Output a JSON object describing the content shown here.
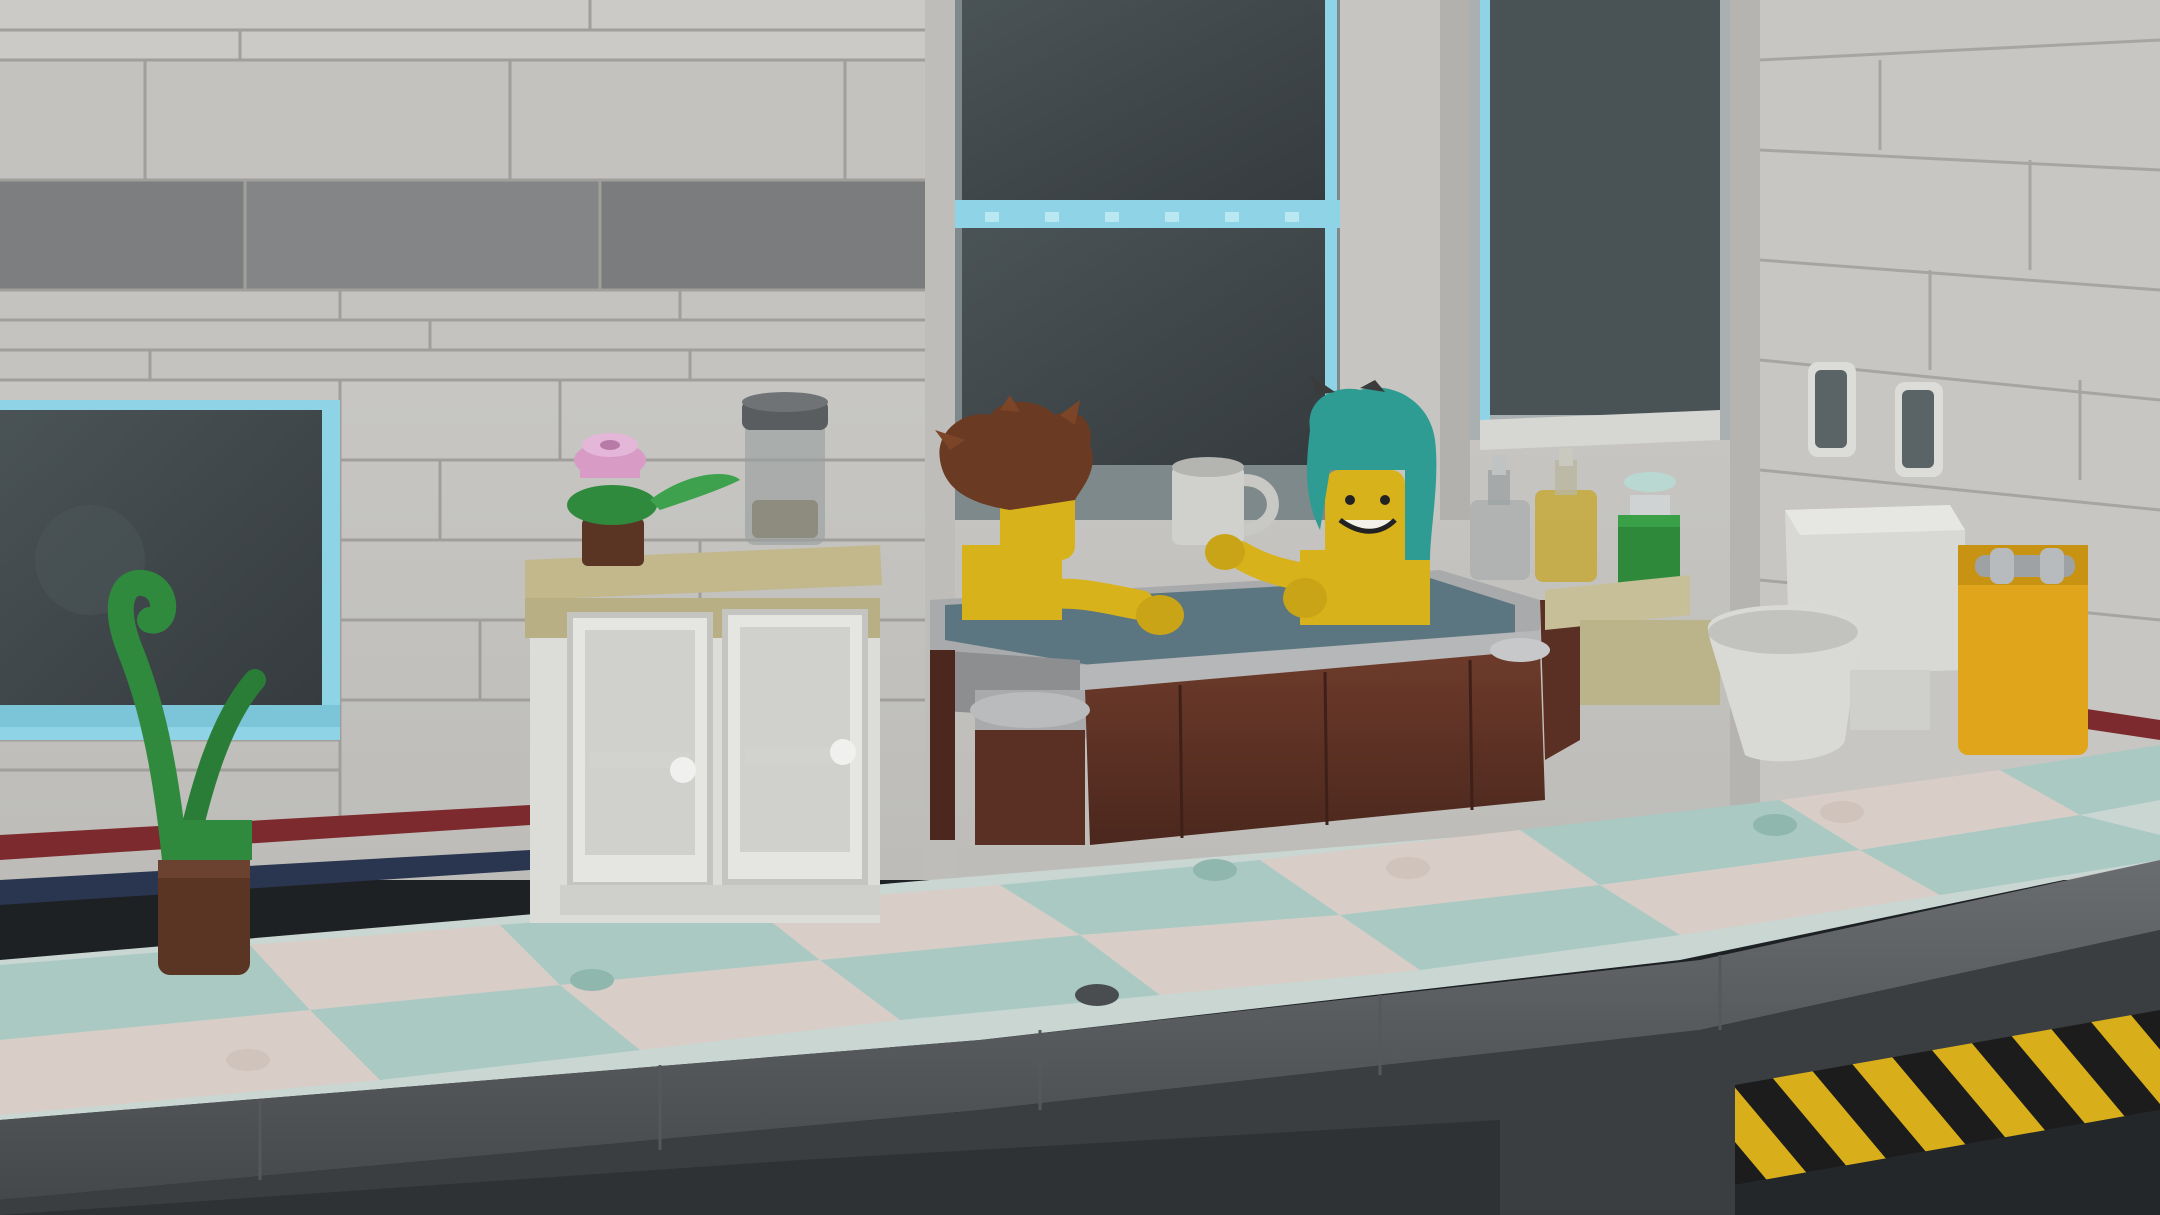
{
  "scene": {
    "description_tag": "lego-bathroom-render",
    "colors": {
      "wall_light": "#c9c8c4",
      "wall_mid": "#b3b2ae",
      "wall_dark": "#7f8182",
      "brick_line": "#9a9996",
      "glass_dark": "#3f4649",
      "glass_edge": "#8fd3e6",
      "stripe_red": "#7d2a2e",
      "stripe_navy": "#2a3650",
      "tile_mint": "#a9c9c2",
      "tile_pink": "#d9cdc7",
      "floor_edge": "#5d6063",
      "floor_edge_dark": "#3b3e41",
      "tub_brown": "#5a3024",
      "tub_brown_light": "#6d3b2b",
      "tub_rim": "#a8aaab",
      "water": "#5b7680",
      "minifig_yellow": "#d8b21a",
      "hair_brown": "#6b3a22",
      "hair_teal": "#2e9c93",
      "cabinet_white": "#dcdcd9",
      "cabinet_top": "#c2b88c",
      "plant_green": "#2f8a3e",
      "pot_brown": "#5a3524",
      "flower_pink": "#d89bc6",
      "toilet_white": "#d8d8d5",
      "towel_yellow": "#e0a51a",
      "hazard_yellow": "#d8ae1a",
      "hazard_black": "#1c1c1c",
      "green_block": "#2e8a3a",
      "tan": "#c6bf98"
    },
    "objects": [
      "wall-panels",
      "left-window",
      "center-window",
      "right-window",
      "cabinet",
      "potted-plant",
      "flower",
      "jar",
      "bathtub",
      "minifig-left",
      "minifig-right",
      "mug",
      "bottles",
      "toilet",
      "towel-holder",
      "hazard-stripes"
    ]
  }
}
